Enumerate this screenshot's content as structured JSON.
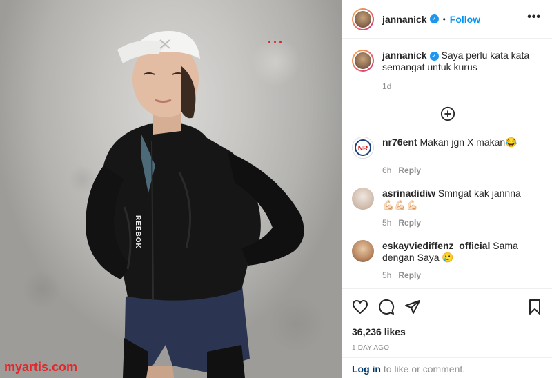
{
  "photo": {
    "dots": "...",
    "jacket_text": "REEBOK",
    "watermark": "myartis.com"
  },
  "header": {
    "username": "jannanick",
    "follow_label": "Follow",
    "separator": "•",
    "more_icon": "more-icon"
  },
  "caption": {
    "username": "jannanick",
    "text": "Saya perlu kata kata semangat untuk kurus",
    "time": "1d"
  },
  "load_more_icon": "plus-circle-icon",
  "comments": [
    {
      "username": "nr76ent",
      "text": "Makan jgn X makan😂",
      "time": "6h",
      "reply": "Reply",
      "avatar_color": "#ffffff"
    },
    {
      "username": "asrinadidiw",
      "text": "Smngat kak jannna 💪🏻💪🏻💪🏻",
      "time": "5h",
      "reply": "Reply",
      "avatar_color": "#d8cfc8"
    },
    {
      "username": "eskayviediffenz_official",
      "text": "Sama dengan Saya 🥲",
      "time": "5h",
      "reply": "Reply",
      "avatar_color": "#c9a07a"
    }
  ],
  "actions": {
    "likes": "36,236 likes",
    "date": "1 DAY AGO"
  },
  "login": {
    "link": "Log in",
    "rest": " to like or comment."
  },
  "colors": {
    "accent": "#0095f6",
    "verified": "#1e96f0",
    "watermark": "#e3262a"
  }
}
